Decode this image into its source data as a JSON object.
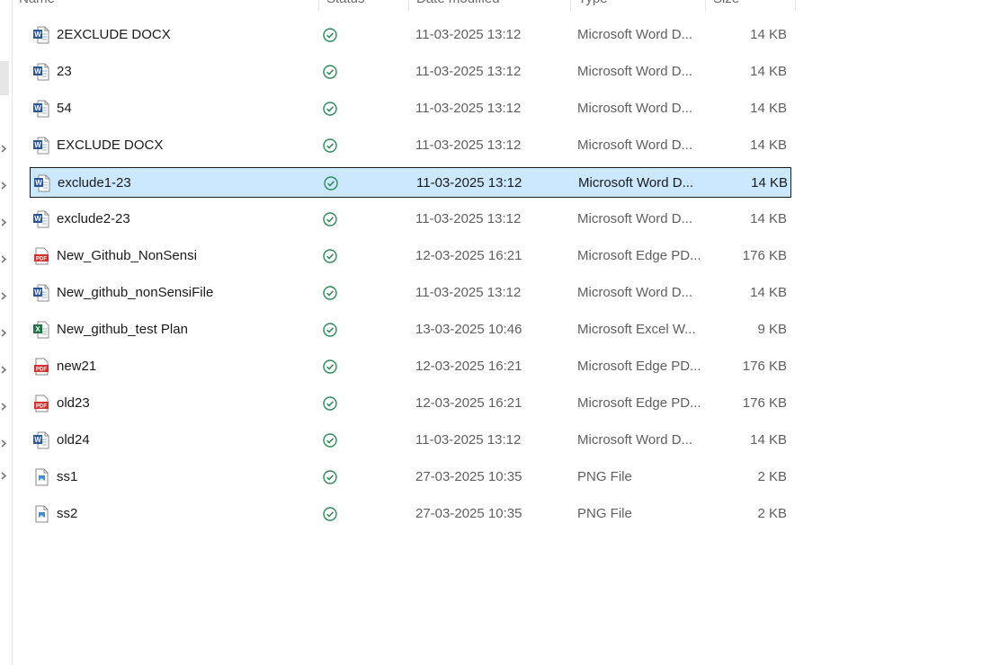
{
  "columns": [
    "Name",
    "Status",
    "Date modified",
    "Type",
    "Size"
  ],
  "status_icon": "check-circle-icon",
  "colors": {
    "selected_bg": "#cce8ff",
    "status_green": "#2e8b57",
    "word_blue": "#2b579a",
    "pdf_red": "#d32f2f",
    "excel_green": "#217346"
  },
  "files": [
    {
      "name": "2EXCLUDE DOCX",
      "kind": "word",
      "date": "11-03-2025 13:12",
      "type": "Microsoft Word D...",
      "size": "14 KB"
    },
    {
      "name": "23",
      "kind": "word",
      "date": "11-03-2025 13:12",
      "type": "Microsoft Word D...",
      "size": "14 KB"
    },
    {
      "name": "54",
      "kind": "word",
      "date": "11-03-2025 13:12",
      "type": "Microsoft Word D...",
      "size": "14 KB"
    },
    {
      "name": "EXCLUDE DOCX",
      "kind": "word",
      "date": "11-03-2025 13:12",
      "type": "Microsoft Word D...",
      "size": "14 KB"
    },
    {
      "name": "exclude1-23",
      "kind": "word",
      "date": "11-03-2025 13:12",
      "type": "Microsoft Word D...",
      "size": "14 KB",
      "selected": true
    },
    {
      "name": "exclude2-23",
      "kind": "word",
      "date": "11-03-2025 13:12",
      "type": "Microsoft Word D...",
      "size": "14 KB"
    },
    {
      "name": "New_Github_NonSensi",
      "kind": "pdf",
      "date": "12-03-2025 16:21",
      "type": "Microsoft Edge PD...",
      "size": "176 KB"
    },
    {
      "name": "New_github_nonSensiFile",
      "kind": "word",
      "date": "11-03-2025 13:12",
      "type": "Microsoft Word D...",
      "size": "14 KB"
    },
    {
      "name": "New_github_test Plan",
      "kind": "excel",
      "date": "13-03-2025 10:46",
      "type": "Microsoft Excel W...",
      "size": "9 KB"
    },
    {
      "name": "new21",
      "kind": "pdf",
      "date": "12-03-2025 16:21",
      "type": "Microsoft Edge PD...",
      "size": "176 KB"
    },
    {
      "name": "old23",
      "kind": "pdf",
      "date": "12-03-2025 16:21",
      "type": "Microsoft Edge PD...",
      "size": "176 KB"
    },
    {
      "name": "old24",
      "kind": "word",
      "date": "11-03-2025 13:12",
      "type": "Microsoft Word D...",
      "size": "14 KB"
    },
    {
      "name": "ss1",
      "kind": "png",
      "date": "27-03-2025 10:35",
      "type": "PNG File",
      "size": "2 KB"
    },
    {
      "name": "ss2",
      "kind": "png",
      "date": "27-03-2025 10:35",
      "type": "PNG File",
      "size": "2 KB"
    }
  ]
}
